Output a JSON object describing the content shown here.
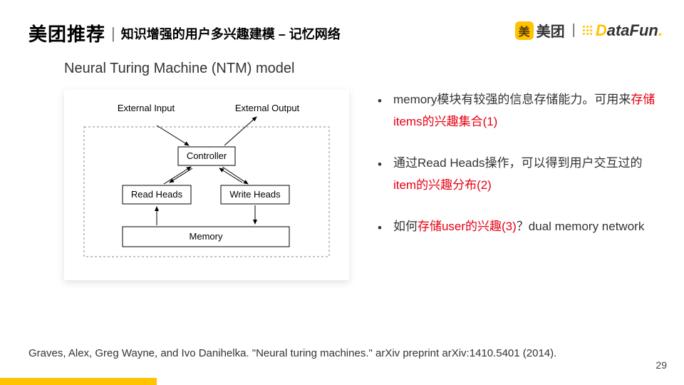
{
  "header": {
    "title_main": "美团推荐",
    "separator": "|",
    "title_sub": "知识增强的用户多兴趣建模 – 记忆网络"
  },
  "brand": {
    "badge": "美",
    "meituan_text": "美团",
    "pipe": "|",
    "datafun_d": "D",
    "datafun_rest": "ataFun",
    "datafun_dot": "."
  },
  "diagram": {
    "title": "Neural Turing Machine (NTM) model",
    "labels": {
      "ext_input": "External Input",
      "ext_output": "External Output",
      "controller": "Controller",
      "read_heads": "Read Heads",
      "write_heads": "Write Heads",
      "memory": "Memory"
    }
  },
  "bullets": [
    {
      "pre": "memory模块有较强的信息存储能力。可用来",
      "red": "存储items的兴趣集合(1)",
      "post": ""
    },
    {
      "pre": "通过Read Heads操作，可以得到用户交互过的",
      "red": "item的兴趣分布(2)",
      "post": ""
    },
    {
      "pre": "如何",
      "red": "存储user的兴趣(3)",
      "post": "？dual memory network"
    }
  ],
  "citation": "Graves, Alex, Greg Wayne, and Ivo Danihelka. \"Neural turing machines.\" arXiv preprint arXiv:1410.5401 (2014).",
  "page_number": "29"
}
